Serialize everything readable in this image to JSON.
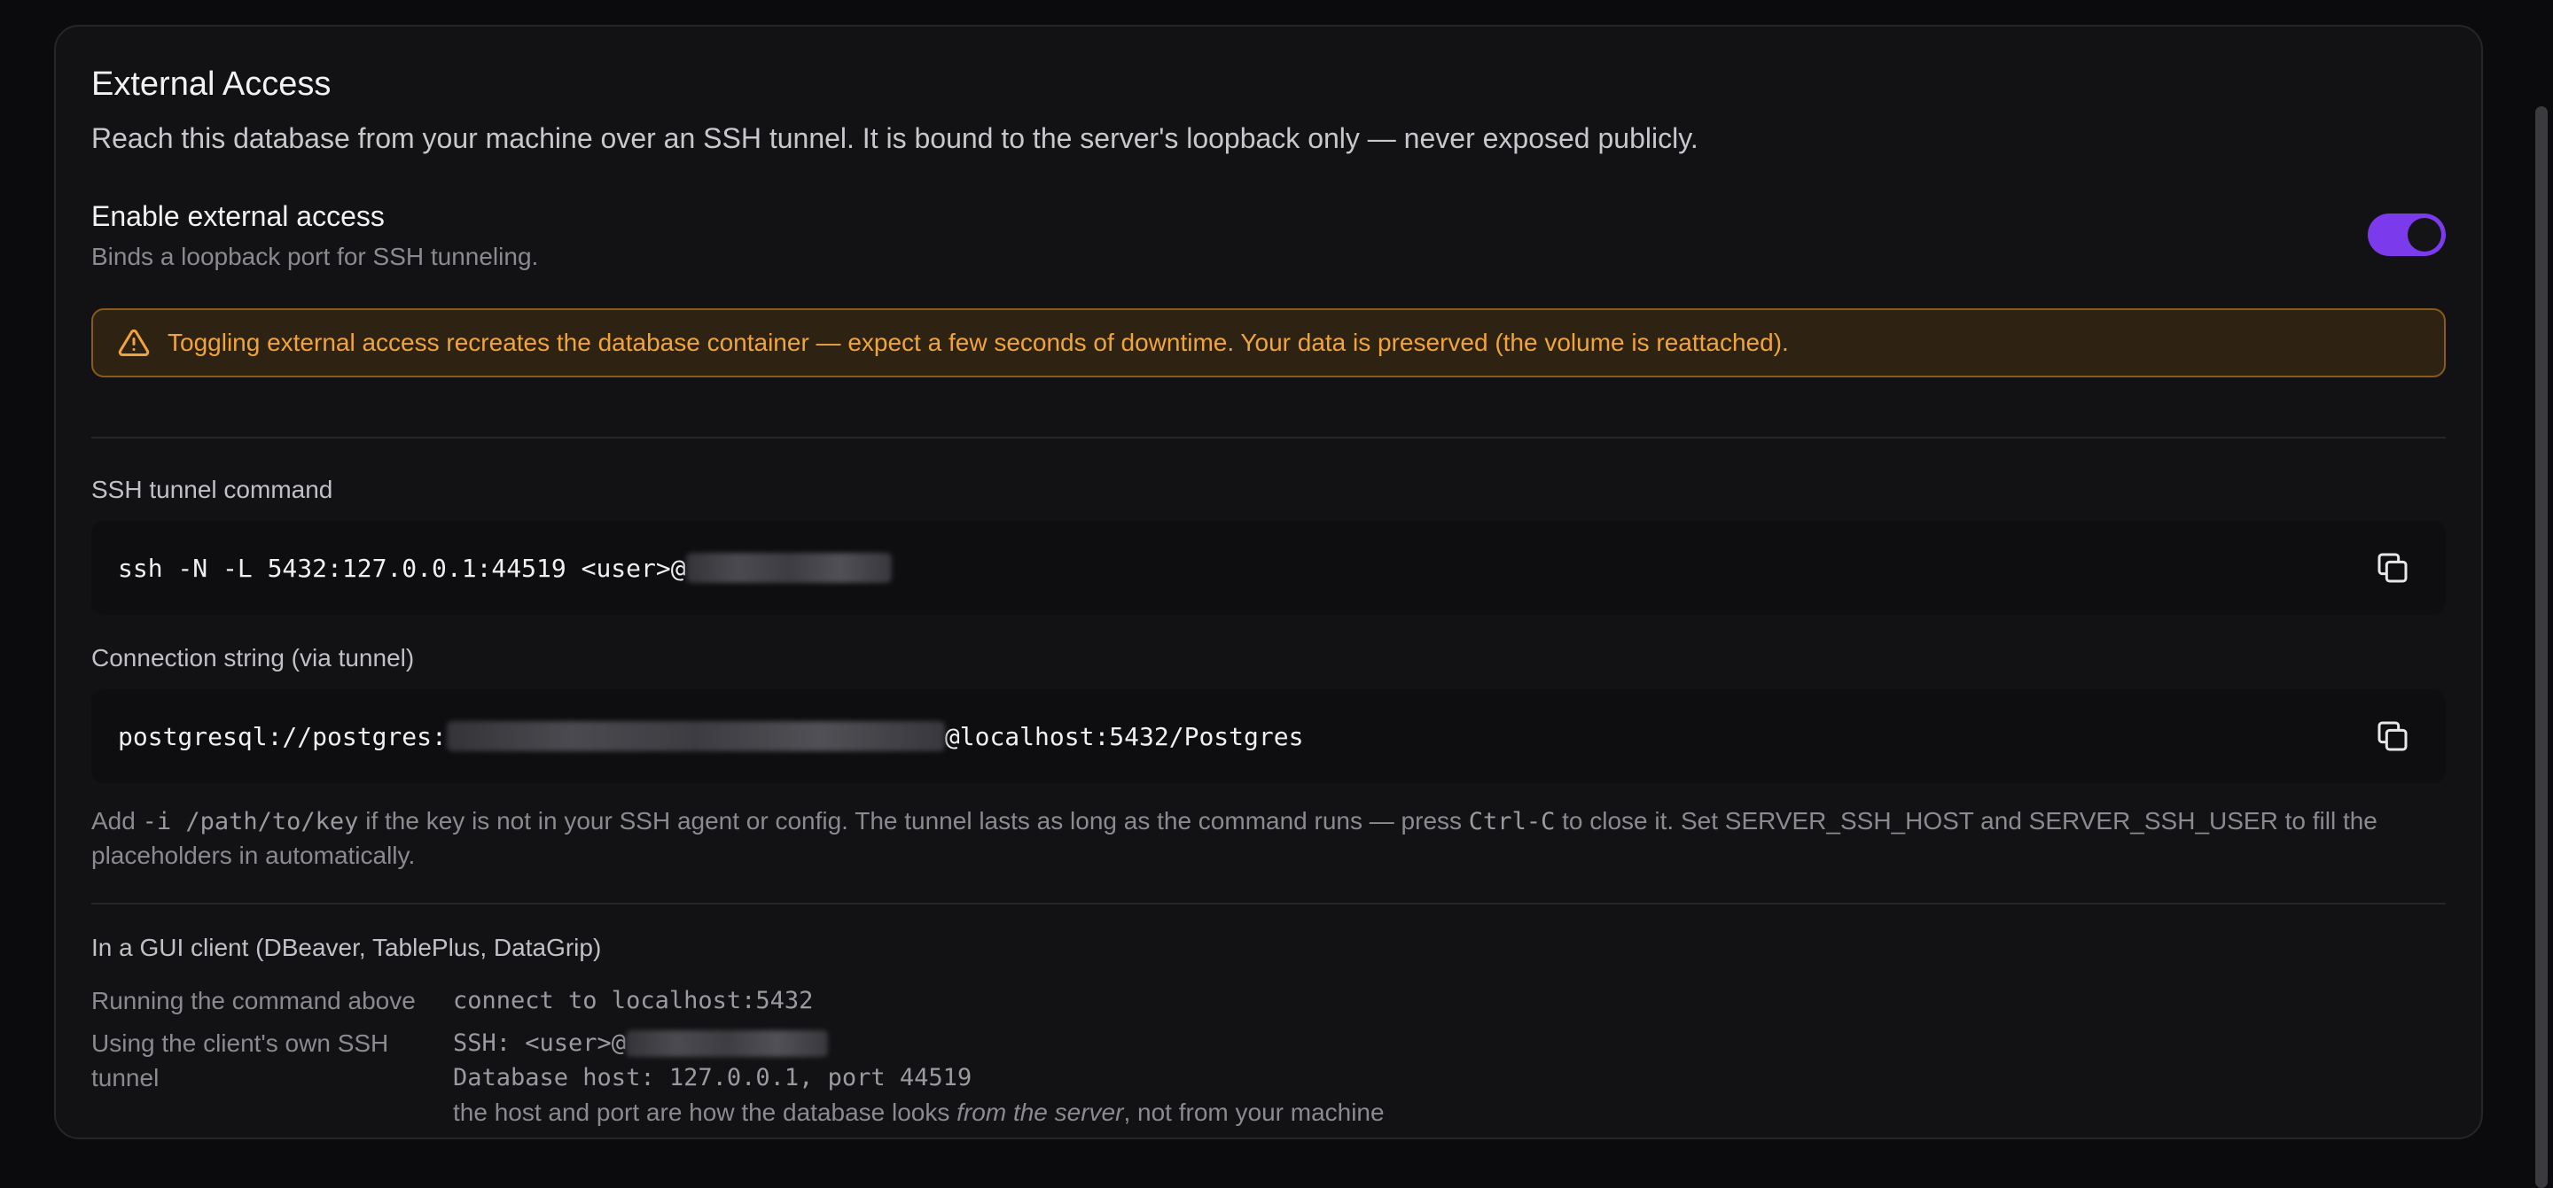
{
  "section": {
    "title": "External Access",
    "subtitle": "Reach this database from your machine over an SSH tunnel. It is bound to the server's loopback only — never exposed publicly."
  },
  "toggle": {
    "label": "Enable external access",
    "hint": "Binds a loopback port for SSH tunneling.",
    "enabled": true,
    "accent": "#7c3aed"
  },
  "warning": {
    "icon": "warning-triangle-icon",
    "text": "Toggling external access recreates the database container — expect a few seconds of downtime. Your data is preserved (the volume is reattached)."
  },
  "ssh": {
    "label": "SSH tunnel command",
    "command_prefix": "ssh -N -L 5432:127.0.0.1:44519 <user>@",
    "copy_icon": "copy-icon"
  },
  "conn": {
    "label": "Connection string (via tunnel)",
    "prefix": "postgresql://postgres:",
    "suffix": "@localhost:5432/Postgres",
    "copy_icon": "copy-icon"
  },
  "help": {
    "t1": "Add ",
    "c1": "-i /path/to/key",
    "t2": " if the key is not in your SSH agent or config. The tunnel lasts as long as the command runs — press ",
    "c2": "Ctrl-C",
    "t3": " to close it. Set SERVER_SSH_HOST and SERVER_SSH_USER to fill the placeholders in automatically."
  },
  "gui": {
    "title": "In a GUI client (DBeaver, TablePlus, DataGrip)",
    "row1_label": "Running the command above",
    "row1_value": "connect to localhost:5432",
    "row2_label": "Using the client's own SSH tunnel",
    "row2_ssh_prefix": "SSH: <user>@",
    "row2_db": "Database host: 127.0.0.1, port 44519",
    "row2_note_a": "the host and port are how the database looks ",
    "row2_note_em": "from the server",
    "row2_note_b": ", not from your machine"
  }
}
